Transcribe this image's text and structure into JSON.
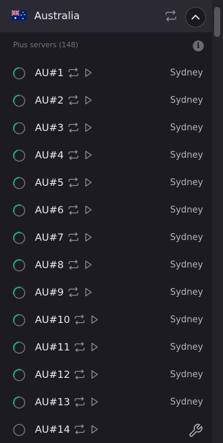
{
  "country": {
    "name": "Australia",
    "flag_icon": "australia-flag-icon"
  },
  "section": {
    "label": "Plus servers (148)"
  },
  "colors": {
    "background": "#1c1b22",
    "header": "#2b2a33",
    "load_accent": "#1fa38a",
    "ring_base": "#6b6a73"
  },
  "servers": [
    {
      "name": "AU#1",
      "city": "Sydney",
      "load": 0.3
    },
    {
      "name": "AU#2",
      "city": "Sydney",
      "load": 0.3
    },
    {
      "name": "AU#3",
      "city": "Sydney",
      "load": 0.25
    },
    {
      "name": "AU#4",
      "city": "Sydney",
      "load": 0.25
    },
    {
      "name": "AU#5",
      "city": "Sydney",
      "load": 0.3
    },
    {
      "name": "AU#6",
      "city": "Sydney",
      "load": 0.35
    },
    {
      "name": "AU#7",
      "city": "Sydney",
      "load": 0.35
    },
    {
      "name": "AU#8",
      "city": "Sydney",
      "load": 0.35
    },
    {
      "name": "AU#9",
      "city": "Sydney",
      "load": 0.35
    },
    {
      "name": "AU#10",
      "city": "Sydney",
      "load": 0.3
    },
    {
      "name": "AU#11",
      "city": "Sydney",
      "load": 0.3
    },
    {
      "name": "AU#12",
      "city": "Sydney",
      "load": 0.35
    },
    {
      "name": "AU#13",
      "city": "Sydney",
      "load": 0.3
    },
    {
      "name": "AU#14",
      "city": "",
      "load": 0,
      "maintenance": true
    }
  ]
}
